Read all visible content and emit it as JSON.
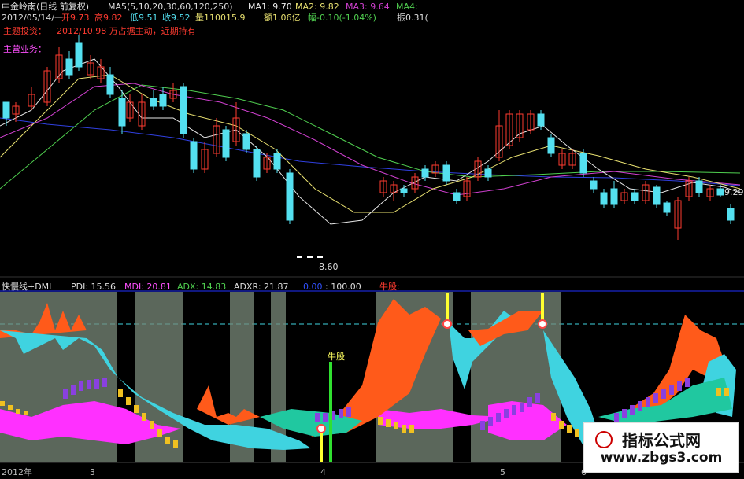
{
  "colors": {
    "bg": "#000000",
    "price_up": "#ff3b30",
    "price_down": "#54e0f0",
    "ma_white": "#e8e8e8",
    "ma_yellow": "#e8e070",
    "ma_magenta": "#d040d0",
    "ma_green": "#50d050",
    "ma_blue": "#3040e0",
    "pdi": "#ff5a1a",
    "mdi": "#3fd3e0",
    "adx_band": "#ff30ff",
    "teal_area": "#20c8a0",
    "gray_zone": "#7a8a7a",
    "yellow_bar": "#f0c020",
    "purple_bar": "#8a40e0"
  },
  "header": {
    "line1": {
      "stock": "中金岭南(日线 前复权)",
      "ma_params": "MA5(5,10,20,30,60,120,250)",
      "ma1": "MA1: 9.70",
      "ma2": "MA2: 9.82",
      "ma3": "MA3: 9.64",
      "ma4": "MA4:"
    },
    "line2": {
      "date": "2012/05/14/一",
      "open": "开9.73",
      "high": "高9.82",
      "low": "低9.51",
      "close": "收9.52",
      "volume": "量110015.9",
      "amount": "额1.06亿",
      "change": "幅-0.10(-1.04%)",
      "amplitude": "振0.31("
    },
    "theme": "主题投资：",
    "theme_value": "2012/10.98 万占据主动，近期持有",
    "business": "主营业务："
  },
  "price_chart": {
    "right_price_label": "9.29",
    "low_price_label": "8.60"
  },
  "indicator": {
    "name": "快慢线+DMI",
    "pdi": "PDI: 15.56",
    "mdi": "MDI: 20.81",
    "adx": "ADX: 14.83",
    "adxr": "ADXR: 21.87",
    "v1": "0.00",
    "v2": ": 100.00",
    "bull_label": "牛股:",
    "bull_marker": "牛股"
  },
  "x_axis": {
    "labels": [
      "2012年",
      "3",
      "4",
      "5",
      "6"
    ]
  },
  "watermark": {
    "title": "指标公式网",
    "url": "www.zbgs3.com"
  }
}
